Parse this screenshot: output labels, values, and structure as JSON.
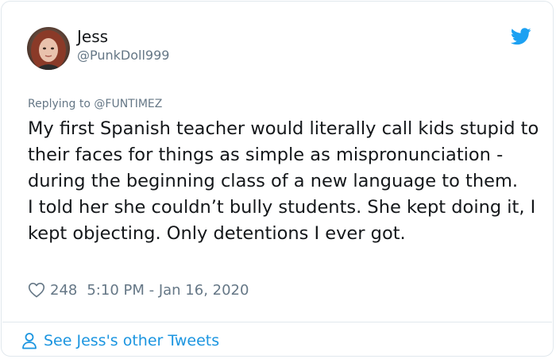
{
  "tweet": {
    "author": {
      "name": "Jess",
      "handle": "@PunkDoll999"
    },
    "reply": {
      "prefix": "Replying to",
      "target": "@FUNTIMEZ"
    },
    "body_lines": [
      "My first Spanish teacher would literally call kids stupid to their faces for things as simple as mispronunciation - during the beginning class of a new language to them.",
      "I told her she couldn’t bully students. She kept doing it, I kept objecting. Only detentions I ever got."
    ],
    "likes": "248",
    "timestamp": "5:10 PM - Jan 16, 2020",
    "see_more": "See Jess's other Tweets"
  },
  "icons": {
    "bird": "twitter-bird-icon",
    "heart": "heart-outline-icon",
    "person": "person-outline-icon"
  },
  "colors": {
    "twitter_blue": "#1da1f2",
    "link_blue": "#1b95e0",
    "secondary_text": "#657786",
    "border": "#e1e8ed"
  }
}
